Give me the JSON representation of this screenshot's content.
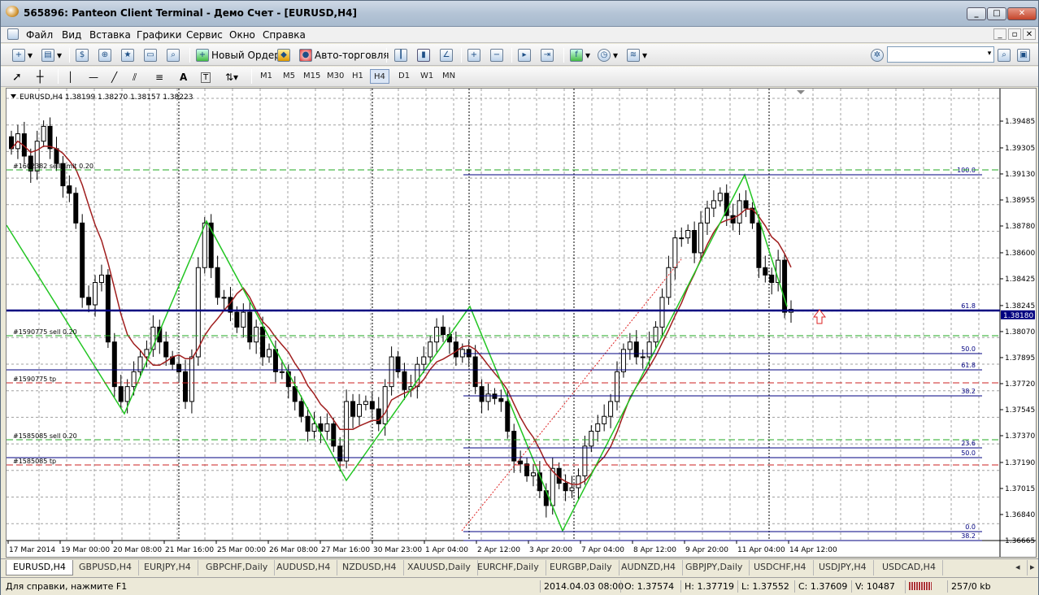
{
  "window": {
    "title": "565896: Panteon Client Terminal - Демо Счет - [EURUSD,H4]"
  },
  "menu": [
    "Файл",
    "Вид",
    "Вставка",
    "Графики",
    "Сервис",
    "Окно",
    "Справка"
  ],
  "toolbar": {
    "new_order": "Новый Ордер",
    "autotrade": "Авто-торговля",
    "search_placeholder": ""
  },
  "timeframes": [
    "M1",
    "M5",
    "M15",
    "M30",
    "H1",
    "H4",
    "D1",
    "W1",
    "MN"
  ],
  "active_timeframe": "H4",
  "chart": {
    "header": "EURUSD,H4  1.38199 1.38270 1.38157 1.38223",
    "price_labels": [
      "1.39485",
      "1.39305",
      "1.39130",
      "1.38955",
      "1.38780",
      "1.38600",
      "1.38425",
      "1.38245",
      "1.38180",
      "1.38070",
      "1.37895",
      "1.37720",
      "1.37545",
      "1.37370",
      "1.37190",
      "1.37015",
      "1.36840",
      "1.36665"
    ],
    "time_labels": [
      "17 Mar 2014",
      "19 Mar 00:00",
      "20 Mar 08:00",
      "21 Mar 16:00",
      "25 Mar 00:00",
      "26 Mar 08:00",
      "27 Mar 16:00",
      "30 Mar 23:00",
      "1 Apr 04:00",
      "2 Apr 12:00",
      "3 Apr 20:00",
      "7 Apr 04:00",
      "8 Apr 12:00",
      "9 Apr 20:00",
      "11 Apr 04:00",
      "14 Apr 12:00"
    ],
    "order_labels": [
      "#1602382 sell limit 0.20",
      "#1590775 sell 0.20",
      "#1590775 tp",
      "#1585085 sell 0.20",
      "#1585085 tp"
    ],
    "fib_labels": [
      "100.0",
      "61.8",
      "50.0",
      "61.8",
      "38.2",
      "23.6",
      "50.0",
      "0.0",
      "38.2"
    ],
    "bid": "1.38180"
  },
  "chart_data": {
    "type": "candlestick",
    "symbol": "EURUSD",
    "timeframe": "H4",
    "ylim": [
      1.36665,
      1.3966
    ],
    "open": 1.38199,
    "high": 1.3827,
    "low": 1.38157,
    "close": 1.38223
  },
  "tabs": [
    "EURUSD,H4",
    "GBPUSD,H4",
    "EURJPY,H4",
    "GBPCHF,Daily",
    "AUDUSD,H4",
    "NZDUSD,H4",
    "XAUUSD,Daily",
    "EURCHF,Daily",
    "EURGBP,Daily",
    "AUDNZD,H4",
    "GBPJPY,Daily",
    "USDCHF,H4",
    "USDJPY,H4",
    "USDCAD,H4"
  ],
  "status": {
    "help": "Для справки, нажмите F1",
    "datetime": "2014.04.03 08:00",
    "open": "O: 1.37574",
    "high": "H: 1.37719",
    "low": "L: 1.37552",
    "close": "C: 1.37609",
    "volume": "V: 10487",
    "traffic": "257/0 kb"
  },
  "colors": {
    "bull": "#000000",
    "grid": "#a0a0a0",
    "zigzag": "#22c522",
    "ma": "#a01e1e",
    "level": "#000080",
    "order": "#22aa22",
    "tp": "#cc2222"
  }
}
